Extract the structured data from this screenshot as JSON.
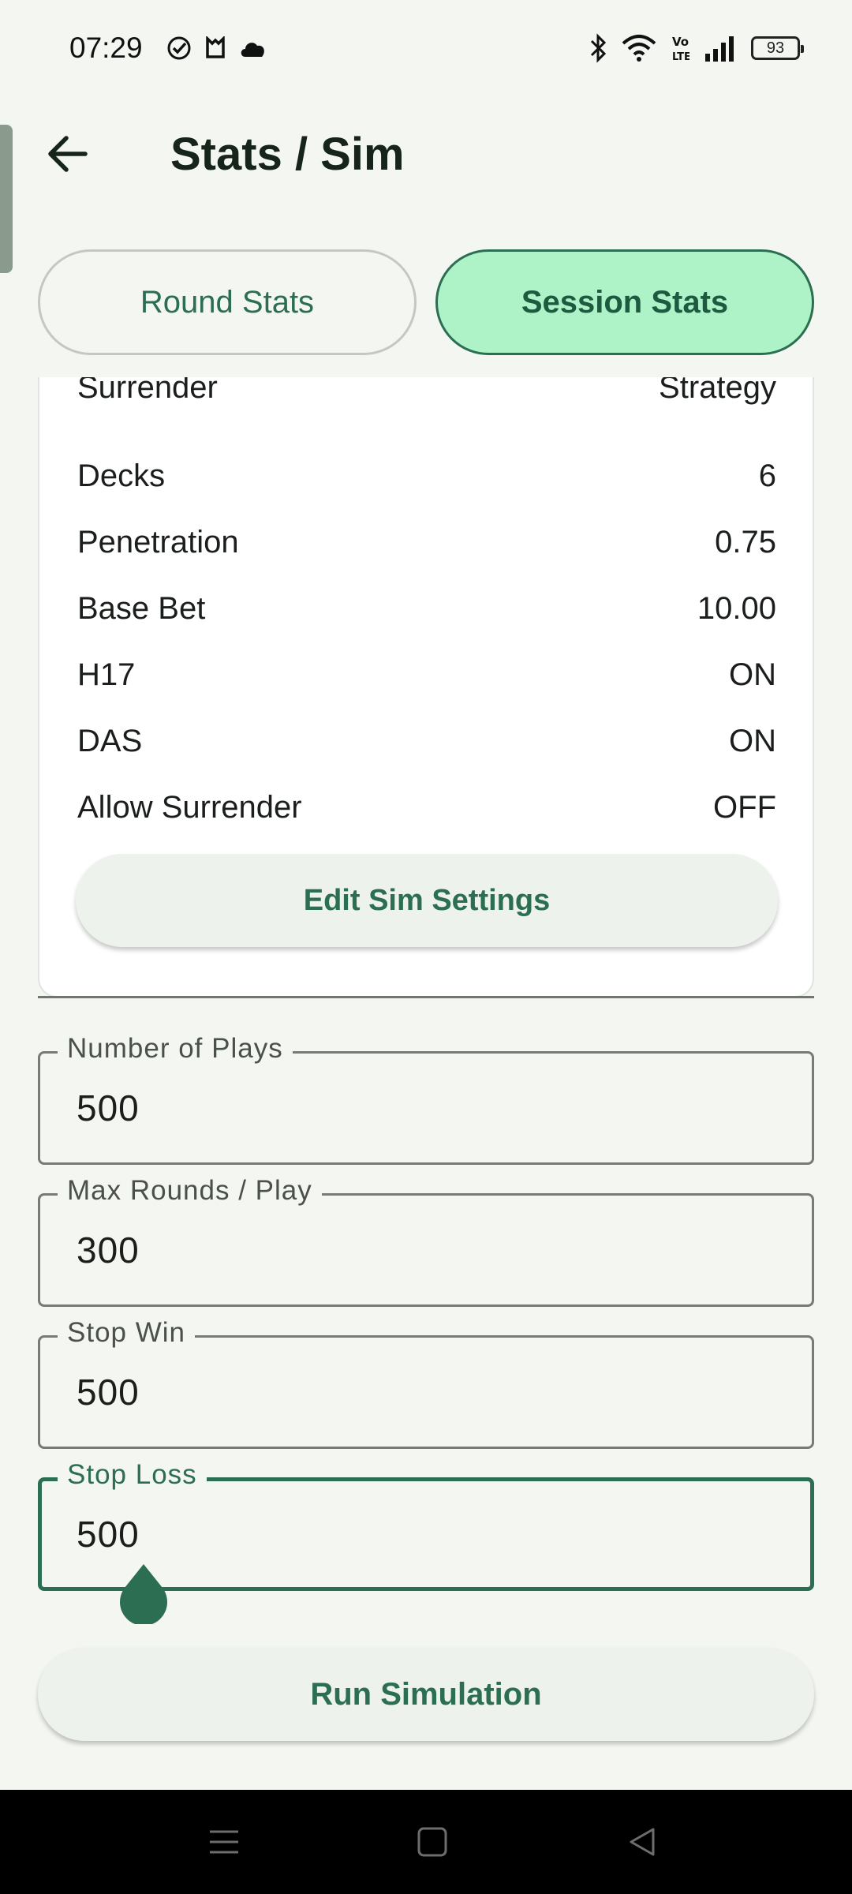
{
  "status_bar": {
    "time": "07:29",
    "left_icons": [
      "check-circle-icon",
      "app-badge-icon",
      "cloud-icon"
    ],
    "right_icons": [
      "bluetooth-icon",
      "wifi-icon",
      "volte-icon",
      "signal-icon"
    ],
    "battery": "93"
  },
  "app_bar": {
    "back_icon": "arrow-left-icon",
    "title": "Stats / Sim"
  },
  "tabs": [
    {
      "label": "Round Stats",
      "active": false
    },
    {
      "label": "Session Stats",
      "active": true
    }
  ],
  "settings": {
    "rows": [
      {
        "label": "Surrender",
        "value": "Strategy"
      },
      {
        "label": "Decks",
        "value": "6"
      },
      {
        "label": "Penetration",
        "value": "0.75"
      },
      {
        "label": "Base Bet",
        "value": "10.00"
      },
      {
        "label": "H17",
        "value": "ON"
      },
      {
        "label": "DAS",
        "value": "ON"
      },
      {
        "label": "Allow Surrender",
        "value": "OFF"
      }
    ],
    "edit_button": "Edit Sim Settings"
  },
  "fields": [
    {
      "label": "Number of Plays",
      "value": "500"
    },
    {
      "label": "Max Rounds / Play",
      "value": "300"
    },
    {
      "label": "Stop Win",
      "value": "500"
    },
    {
      "label": "Stop Loss",
      "value": "500",
      "focused": true
    }
  ],
  "run_button": "Run Simulation",
  "nav_bar": {
    "icons": [
      "menu-icon",
      "home-square-icon",
      "back-triangle-icon"
    ]
  },
  "colors": {
    "accent": "#2b6e51",
    "active_tab_bg": "#aef2c8",
    "background": "#f4f6f2"
  }
}
